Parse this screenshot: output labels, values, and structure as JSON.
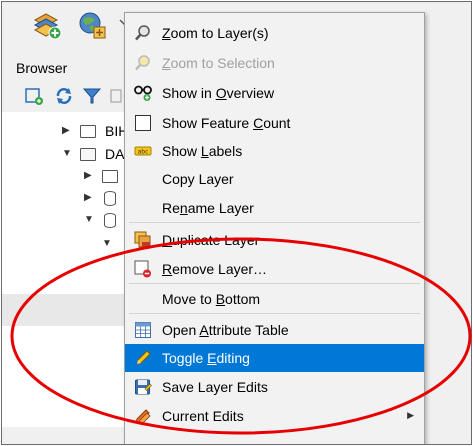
{
  "browser": {
    "title": "Browser",
    "tree": [
      {
        "label": "BIH",
        "kind": "folder",
        "expanded": false
      },
      {
        "label": "DA",
        "kind": "folder",
        "expanded": true
      },
      {
        "label": "",
        "kind": "folder",
        "expanded": false
      },
      {
        "label": "",
        "kind": "database",
        "expanded": false
      },
      {
        "label": "",
        "kind": "database",
        "expanded": true
      }
    ]
  },
  "context_menu": {
    "items": [
      {
        "pre": "",
        "acc": "Z",
        "post": "oom to Layer(s)",
        "icon": "zoom-layer-icon",
        "enabled": true
      },
      {
        "pre": "",
        "acc": "Z",
        "post": "oom to Selection",
        "icon": "zoom-selection-icon",
        "enabled": false
      },
      {
        "pre": "Show in ",
        "acc": "O",
        "post": "verview",
        "icon": "overview-icon",
        "enabled": true
      },
      {
        "pre": "Show Feature ",
        "acc": "C",
        "post": "ount",
        "icon": "feature-count-checkbox",
        "enabled": true
      },
      {
        "pre": "Show ",
        "acc": "L",
        "post": "abels",
        "icon": "labels-icon",
        "enabled": true
      },
      {
        "pre": "Copy Layer",
        "acc": "",
        "post": "",
        "icon": "",
        "enabled": true
      },
      {
        "pre": "Re",
        "acc": "n",
        "post": "ame Layer",
        "icon": "",
        "enabled": true
      },
      {
        "pre": "",
        "acc": "D",
        "post": "uplicate Layer",
        "icon": "duplicate-layer-icon",
        "enabled": true
      },
      {
        "pre": "",
        "acc": "R",
        "post": "emove Layer…",
        "icon": "remove-layer-icon",
        "enabled": true
      },
      {
        "pre": "Move to ",
        "acc": "B",
        "post": "ottom",
        "icon": "",
        "enabled": true
      },
      {
        "pre": "Open ",
        "acc": "A",
        "post": "ttribute Table",
        "icon": "attribute-table-icon",
        "enabled": true
      },
      {
        "pre": "Toggle ",
        "acc": "E",
        "post": "diting",
        "icon": "pencil-icon",
        "enabled": true,
        "highlighted": true
      },
      {
        "pre": "Save Layer Edits",
        "acc": "",
        "post": "",
        "icon": "save-edits-icon",
        "enabled": true
      },
      {
        "pre": "Current Edits",
        "acc": "",
        "post": "",
        "icon": "current-edits-icon",
        "enabled": true,
        "submenu": true
      }
    ]
  },
  "annotation": {
    "shape": "ellipse",
    "color": "#e60000"
  },
  "colors": {
    "highlight": "#0078d7",
    "menu_bg": "#f2f2f2",
    "annotation": "#e60000"
  }
}
